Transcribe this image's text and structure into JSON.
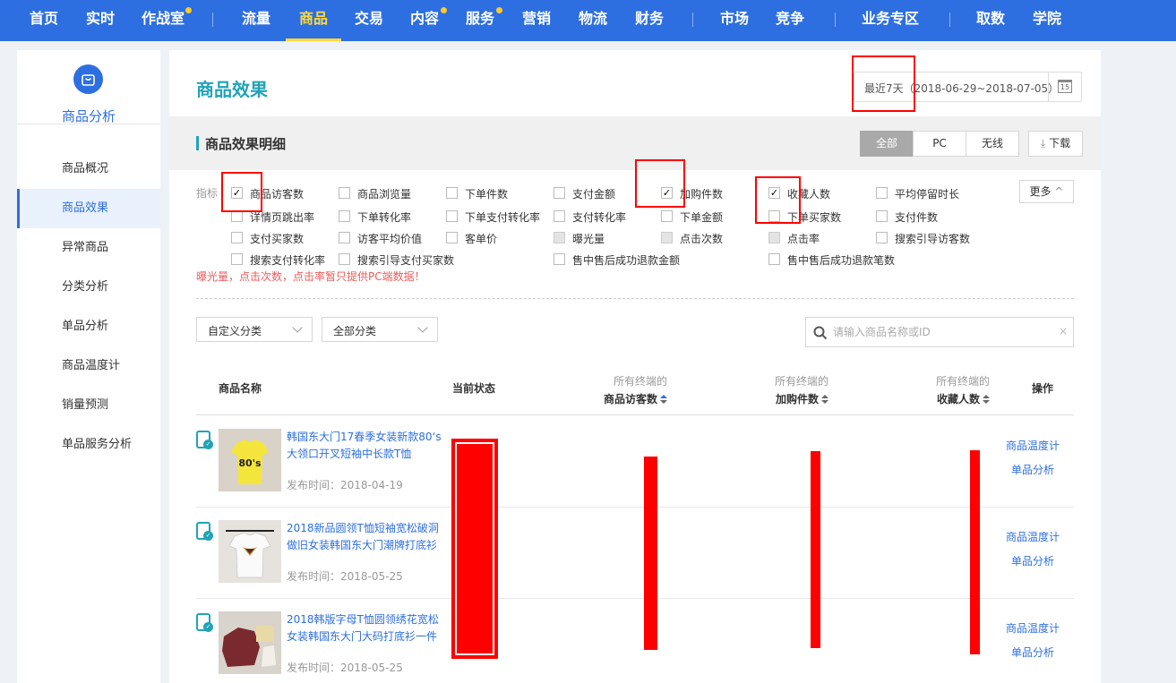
{
  "topnav": {
    "items": [
      {
        "label": "首页"
      },
      {
        "label": "实时"
      },
      {
        "label": "作战室"
      },
      {
        "label": "流量"
      },
      {
        "label": "商品"
      },
      {
        "label": "交易"
      },
      {
        "label": "内容"
      },
      {
        "label": "服务"
      },
      {
        "label": "营销"
      },
      {
        "label": "物流"
      },
      {
        "label": "财务"
      },
      {
        "label": "市场"
      },
      {
        "label": "竞争"
      },
      {
        "label": "业务专区"
      },
      {
        "label": "取数"
      },
      {
        "label": "学院"
      }
    ]
  },
  "sidebar": {
    "title": "商品分析",
    "items": [
      {
        "label": "商品概况"
      },
      {
        "label": "商品效果"
      },
      {
        "label": "异常商品"
      },
      {
        "label": "分类分析"
      },
      {
        "label": "单品分析"
      },
      {
        "label": "商品温度计"
      },
      {
        "label": "销量预测"
      },
      {
        "label": "单品服务分析"
      }
    ]
  },
  "main": {
    "title": "商品效果",
    "date_range": "最近7天（2018-06-29~2018-07-05）",
    "calendar_day": "15",
    "section_title": "商品效果明细",
    "segments": [
      "全部",
      "PC",
      "无线"
    ],
    "download_label": "下载",
    "metric_label": "指标",
    "metrics": [
      {
        "label": "商品访客数",
        "checked": true
      },
      {
        "label": "商品浏览量",
        "checked": false
      },
      {
        "label": "下单件数",
        "checked": false
      },
      {
        "label": "支付金额",
        "checked": false
      },
      {
        "label": "加购件数",
        "checked": true
      },
      {
        "label": "收藏人数",
        "checked": true
      },
      {
        "label": "平均停留时长",
        "checked": false
      },
      {
        "label": "详情页跳出率",
        "checked": false
      },
      {
        "label": "下单转化率",
        "checked": false
      },
      {
        "label": "下单支付转化率",
        "checked": false
      },
      {
        "label": "支付转化率",
        "checked": false
      },
      {
        "label": "下单金额",
        "checked": false
      },
      {
        "label": "下单买家数",
        "checked": false
      },
      {
        "label": "支付件数",
        "checked": false
      },
      {
        "label": "支付买家数",
        "checked": false
      },
      {
        "label": "访客平均价值",
        "checked": false
      },
      {
        "label": "客单价",
        "checked": false
      },
      {
        "label": "曝光量",
        "checked": false,
        "disabled": true
      },
      {
        "label": "点击次数",
        "checked": false,
        "disabled": true
      },
      {
        "label": "点击率",
        "checked": false,
        "disabled": true
      },
      {
        "label": "搜索引导访客数",
        "checked": false
      },
      {
        "label": "搜索支付转化率",
        "checked": false
      },
      {
        "label": "搜索引导支付买家数",
        "checked": false
      },
      {
        "label": "售中售后成功退款金额",
        "checked": false
      },
      {
        "label": "售中售后成功退款笔数",
        "checked": false
      }
    ],
    "more_label": "更多",
    "warning": "曝光量，点击次数，点击率暂只提供PC端数据！",
    "filter1": "自定义分类",
    "filter2": "全部分类",
    "search_placeholder": "请输入商品名称或ID",
    "table": {
      "headers": {
        "name": "商品名称",
        "status": "当前状态",
        "col_upper": "所有终端的",
        "visitors": "商品访客数",
        "cart": "加购件数",
        "fav": "收藏人数",
        "op": "操作"
      },
      "rows": [
        {
          "name": "韩国东大门17春季女装新款80‘s大领口开叉短袖中长款T恤",
          "pub_date": "发布时间：2018-04-19",
          "thumb_text": "80's",
          "op1": "商品温度计",
          "op2": "单品分析"
        },
        {
          "name": "2018新品圆领T恤短袖宽松破洞做旧女装韩国东大门潮牌打底衫",
          "pub_date": "发布时间：2018-05-25",
          "op1": "商品温度计",
          "op2": "单品分析"
        },
        {
          "name": "2018韩版字母T恤圆领绣花宽松女装韩国东大门大码打底衫一件",
          "pub_date": "发布时间：2018-05-25",
          "op1": "商品温度计",
          "op2": "单品分析"
        }
      ]
    }
  },
  "colors": {
    "brand_blue": "#2d6fe0",
    "teal": "#21a3b7",
    "nav_active": "#ffd93a",
    "warn_red": "#f05a5a",
    "annotation_red": "#ff0000"
  },
  "icons": [
    "cart-bag-icon",
    "calendar-icon",
    "download-icon",
    "chevron-up-icon",
    "chevron-down-icon",
    "search-icon",
    "clear-icon",
    "sort-icon",
    "mobile-check-icon"
  ]
}
